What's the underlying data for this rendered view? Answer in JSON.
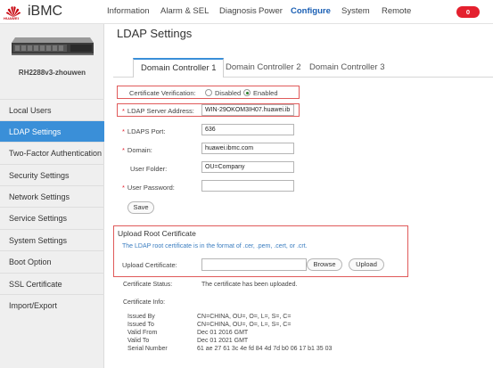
{
  "header": {
    "brand": "HUAWEI",
    "app_name": "iBMC",
    "nav": [
      "Information",
      "Alarm & SEL",
      "Diagnosis",
      "Power",
      "Configure",
      "System",
      "Remote"
    ],
    "active_nav": "Configure",
    "alert_count": "0",
    "colors": {
      "accent": "#1a5fb4",
      "alert": "#e4202e"
    }
  },
  "sidebar": {
    "server_name": "RH2288v3-zhouwen",
    "items": [
      {
        "label": "Local Users"
      },
      {
        "label": "LDAP Settings"
      },
      {
        "label": "Two-Factor Authentication"
      },
      {
        "label": "Security Settings"
      },
      {
        "label": "Network Settings"
      },
      {
        "label": "Service Settings"
      },
      {
        "label": "System Settings"
      },
      {
        "label": "Boot Option"
      },
      {
        "label": "SSL Certificate"
      },
      {
        "label": "Import/Export"
      }
    ],
    "active_item": "LDAP Settings"
  },
  "main": {
    "title": "LDAP Settings",
    "tabs": [
      {
        "label": "Domain Controller 1"
      },
      {
        "label": "Domain Controller 2"
      },
      {
        "label": "Domain Controller 3"
      }
    ],
    "active_tab": "Domain Controller 1",
    "form": {
      "cert_verification_label": "Certificate Verification:",
      "cert_options": [
        "Disabled",
        "Enabled"
      ],
      "cert_selected": "Enabled",
      "server_address_label": "LDAP Server Address:",
      "server_address_value": "WIN-29OKOM3IH07.huawei.ib",
      "port_label": "LDAPS Port:",
      "port_value": "636",
      "domain_label": "Domain:",
      "domain_value": "huawei.ibmc.com",
      "user_folder_label": "User Folder:",
      "user_folder_value": "OU=Company",
      "user_password_label": "User Password:",
      "user_password_value": "",
      "save_label": "Save"
    },
    "upload": {
      "title": "Upload Root Certificate",
      "note": "The LDAP root certificate is in the format of .cer, .pem, .cert, or .crt.",
      "upload_label": "Upload Certificate:",
      "file_value": "",
      "browse_label": "Browse",
      "upload_button_label": "Upload"
    },
    "status": {
      "label": "Certificate Status:",
      "value": "The certificate has been uploaded."
    },
    "cert_info": {
      "label": "Certificate Info:",
      "rows": [
        {
          "key": "Issued By",
          "value": "CN=CHINA, OU=, O=, L=, S=, C="
        },
        {
          "key": "Issued To",
          "value": "CN=CHINA, OU=, O=, L=, S=, C="
        },
        {
          "key": "Valid From",
          "value": "Dec 01 2016 GMT"
        },
        {
          "key": "Valid To",
          "value": "Dec 01 2021 GMT"
        },
        {
          "key": "Serial Number",
          "value": "61 ae 27 61 3c 4e fd 84 4d 7d b0 06 17 b1 35 03"
        }
      ]
    }
  }
}
